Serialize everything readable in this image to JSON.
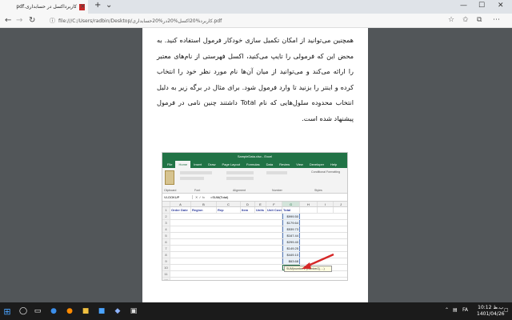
{
  "browser": {
    "tab_title": "کاربرداکسل در حسابداری.pdf",
    "tab_close": "×",
    "new_tab": "+",
    "tab_dropdown": "⌄",
    "window_minimize": "—",
    "window_maximize": "☐",
    "window_close": "✕",
    "back": "←",
    "forward": "→",
    "refresh": "↻",
    "address": "file:///C:/Users/radbin/Desktop/کاربرد%20اکسل%20در%20حسابداری.pdf"
  },
  "pdf": {
    "paragraph": "همچنین می‌توانید از امکان تکمیل سازی خودکار فرمول استفاده کنید. به محض این که فرمولی را تایپ می‌کنید، اکسل فهرستی از نام‌های معتبر را ارائه می‌کند و می‌توانید از میان آن‌ها نام مورد نظر خود را انتخاب کرده و اینتر را بزنید تا وارد فرمول شود. برای مثال در برگه زیر به دلیل انتخاب محدوده سلول‌هایی که نام Total داشتند چنین نامی در فرمول پیشنهاد شده است."
  },
  "excel": {
    "window_title": "SampleData.xlsx - Excel",
    "tabs": [
      "File",
      "Home",
      "Insert",
      "Draw",
      "Page Layout",
      "Formulas",
      "Data",
      "Review",
      "View",
      "Developer",
      "Help"
    ],
    "active_tab": "Home",
    "ribbon_groups": [
      "Clipboard",
      "Font",
      "Alignment",
      "Number",
      "Styles"
    ],
    "ribbon_right": "Conditional Formatting",
    "namebox": "VLOOKUP",
    "fx": "✕ ✓ fx",
    "formula": "=SUM(Total)",
    "columns": [
      "A",
      "B",
      "C",
      "D",
      "E",
      "F",
      "G",
      "H",
      "I",
      "J"
    ],
    "header_row": [
      "Order Date",
      "Region",
      "Rep",
      "Item",
      "Units",
      "Unit Cost",
      "Total"
    ],
    "rows": [
      "1",
      "2",
      "3",
      "4",
      "5",
      "6",
      "7",
      "8",
      "9",
      "10",
      "11",
      "12"
    ],
    "totals": [
      "$999.50",
      "$179.64",
      "$539.73",
      "$167.44",
      "$299.40",
      "$149.25",
      "$449.10",
      "$63.68"
    ],
    "sum_cell": "=SUM(Total)",
    "tooltip": "SUM(number1, [number2], ...)"
  },
  "taskbar": {
    "start": "⊞",
    "search": "◯",
    "time": "10:12 ب.ظ",
    "date": "1401/04/26",
    "lang": "FA",
    "accent": "#217346"
  }
}
